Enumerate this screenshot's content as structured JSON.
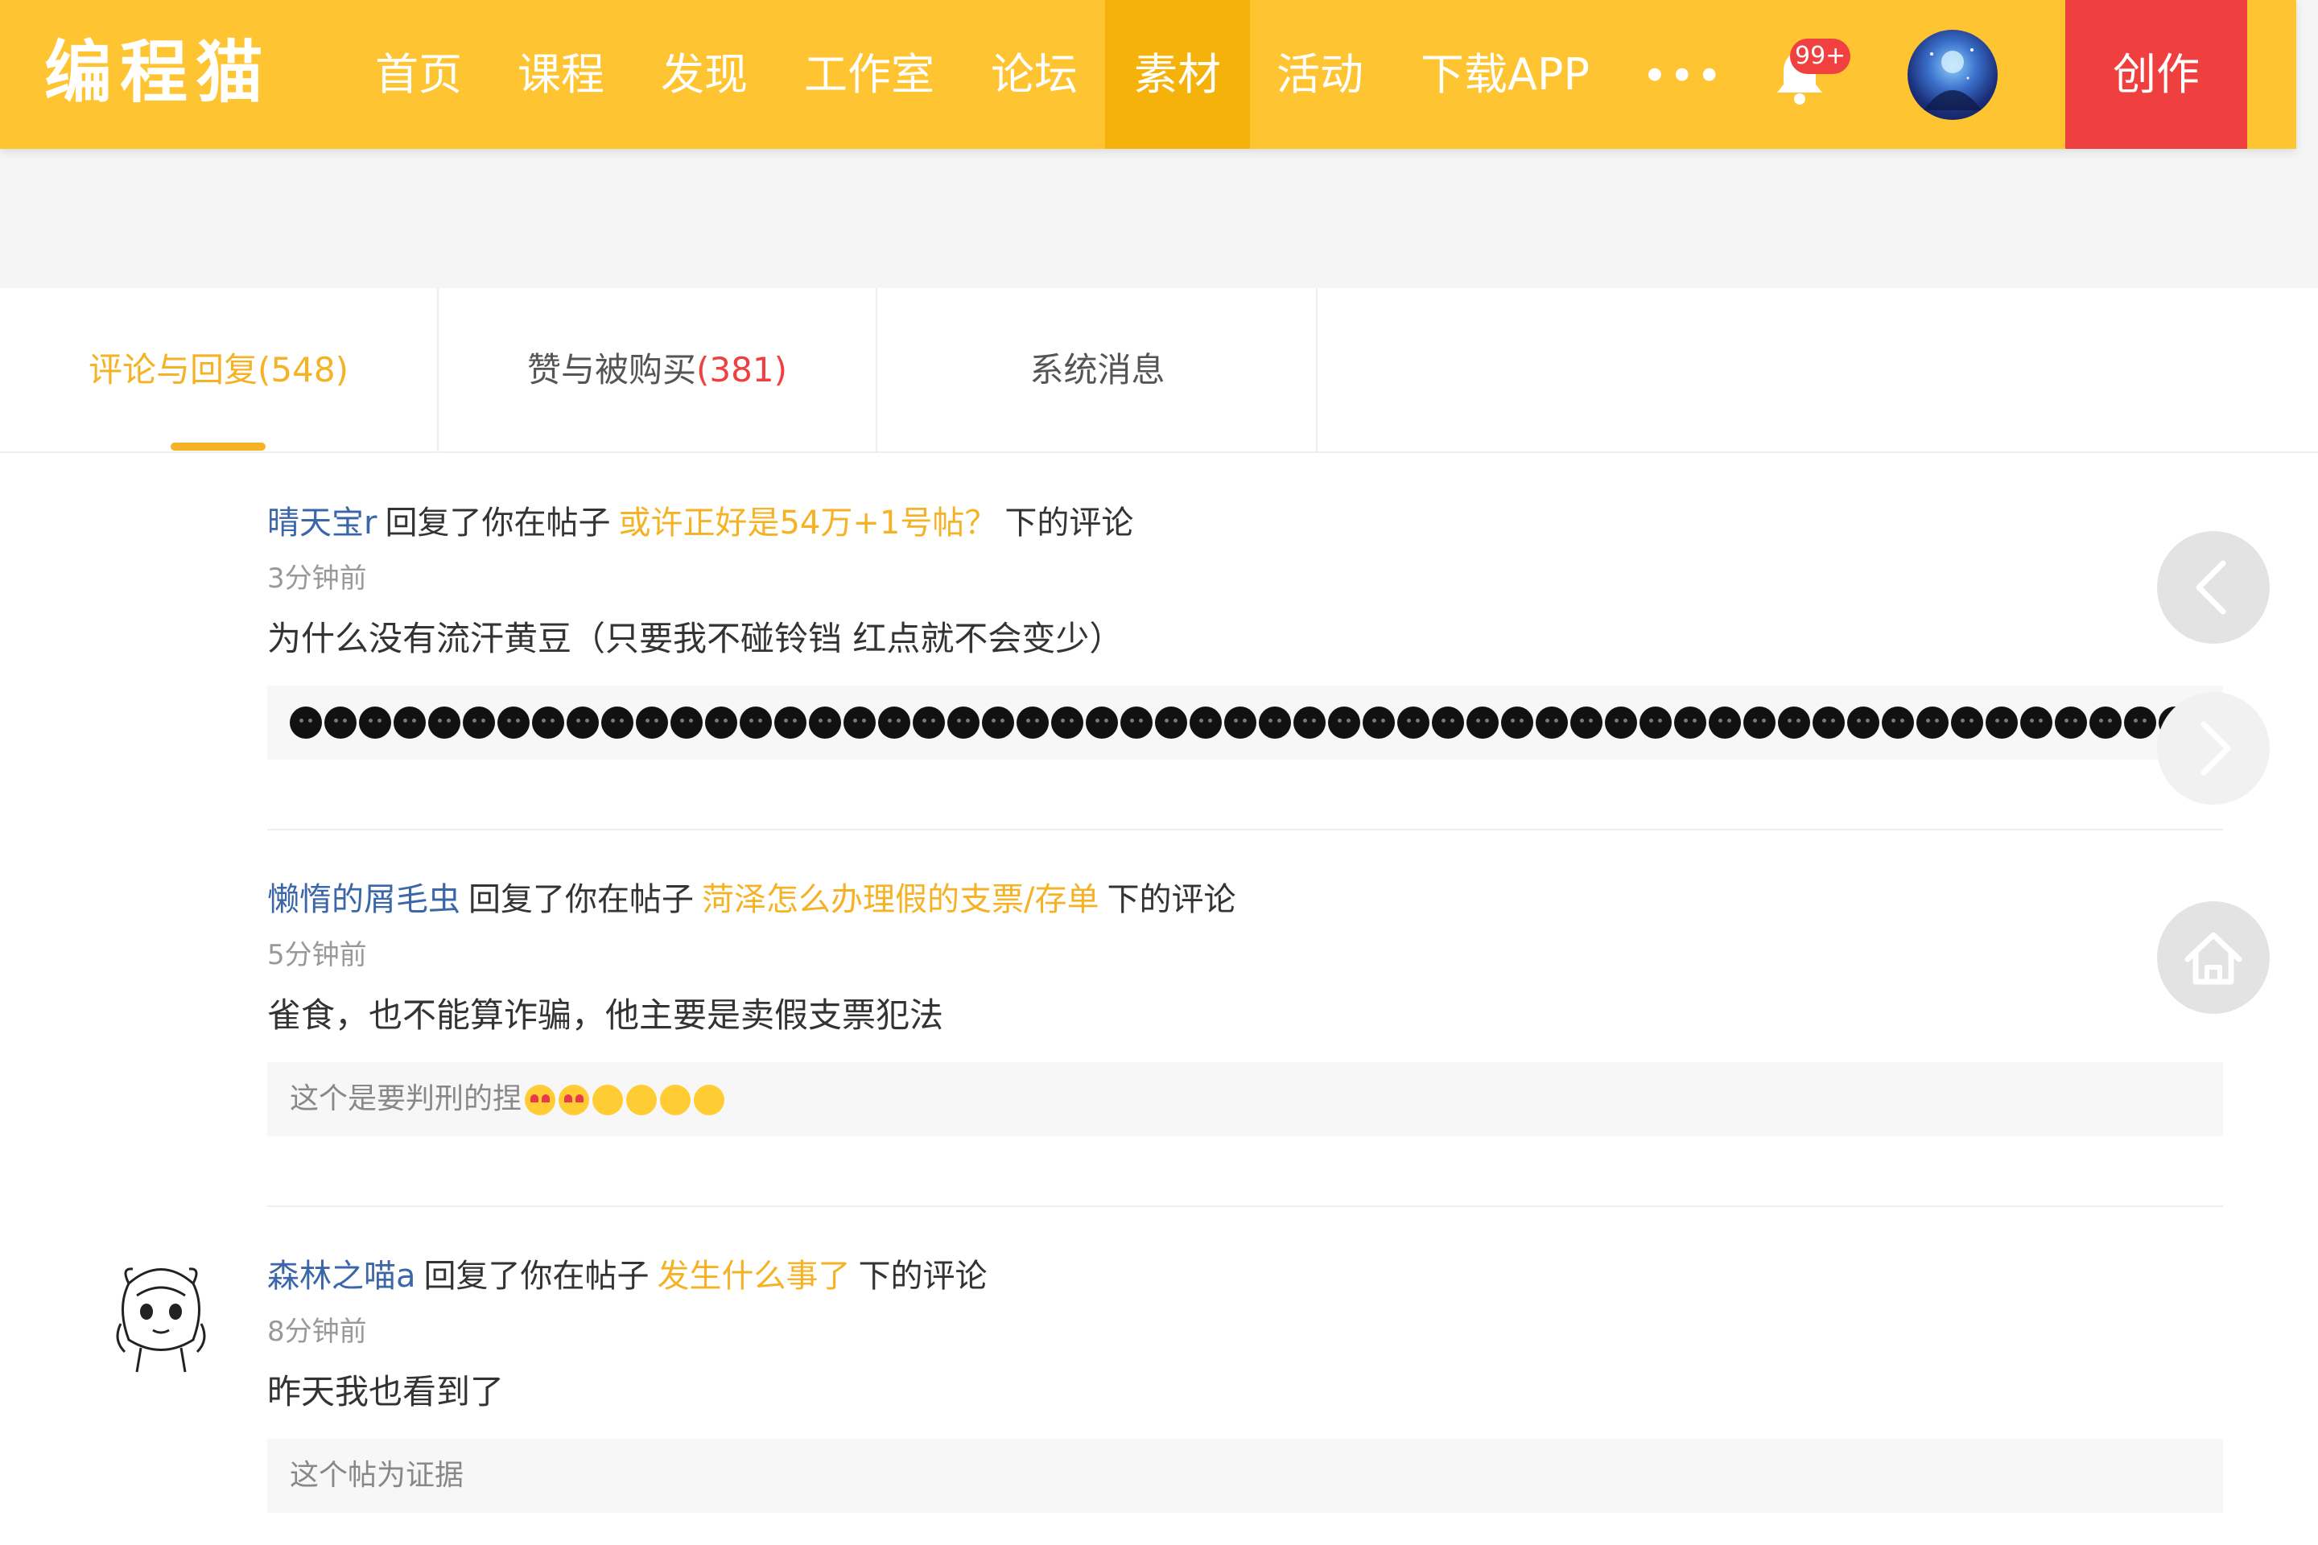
{
  "header": {
    "logo": "编程猫",
    "nav": [
      {
        "label": "首页",
        "active": false
      },
      {
        "label": "课程",
        "active": false
      },
      {
        "label": "发现",
        "active": false
      },
      {
        "label": "工作室",
        "active": false
      },
      {
        "label": "论坛",
        "active": false
      },
      {
        "label": "素材",
        "active": true
      },
      {
        "label": "活动",
        "active": false
      },
      {
        "label": "下载APP",
        "active": false
      }
    ],
    "more_label": "•••",
    "notification_badge": "99+",
    "create_label": "创作",
    "colors": {
      "bar": "#ffc431",
      "active": "#f4b20b",
      "create": "#ef3f3f"
    }
  },
  "tabs": [
    {
      "label": "评论与回复",
      "count": "(548)",
      "active": true
    },
    {
      "label": "赞与被购买",
      "count": "(381)",
      "active": false
    },
    {
      "label": "系统消息",
      "count": "",
      "active": false
    }
  ],
  "messages": [
    {
      "user": "晴天宝r",
      "action": "回复了你在帖子",
      "post": "或许正好是54万+1号帖？",
      "suffix": "下的评论",
      "time": "3分钟前",
      "content": "为什么没有流汗黄豆（只要我不碰铃铛 红点就不会变少）",
      "quote": "",
      "quote_emoji": "black-face-emoji"
    },
    {
      "user": "懒惰的屑毛虫",
      "action": "回复了你在帖子",
      "post": "菏泽怎么办理假的支票/存单",
      "suffix": "下的评论",
      "time": "5分钟前",
      "content": "雀食，也不能算诈骗，他主要是卖假支票犯法",
      "quote": "这个是要判刑的捏",
      "quote_emoji": "face-emojis"
    },
    {
      "user": "森林之喵a",
      "action": "回复了你在帖子",
      "post": "发生什么事了",
      "suffix": "下的评论",
      "time": "8分钟前",
      "content": "昨天我也看到了",
      "quote": "这个帖为证据",
      "quote_emoji": ""
    }
  ],
  "side_buttons": [
    "prev-arrow-icon",
    "next-arrow-icon",
    "home-icon"
  ],
  "accent_colors": {
    "username": "#3b67a8",
    "post_link": "#f5b225",
    "count_red": "#ef4040"
  }
}
